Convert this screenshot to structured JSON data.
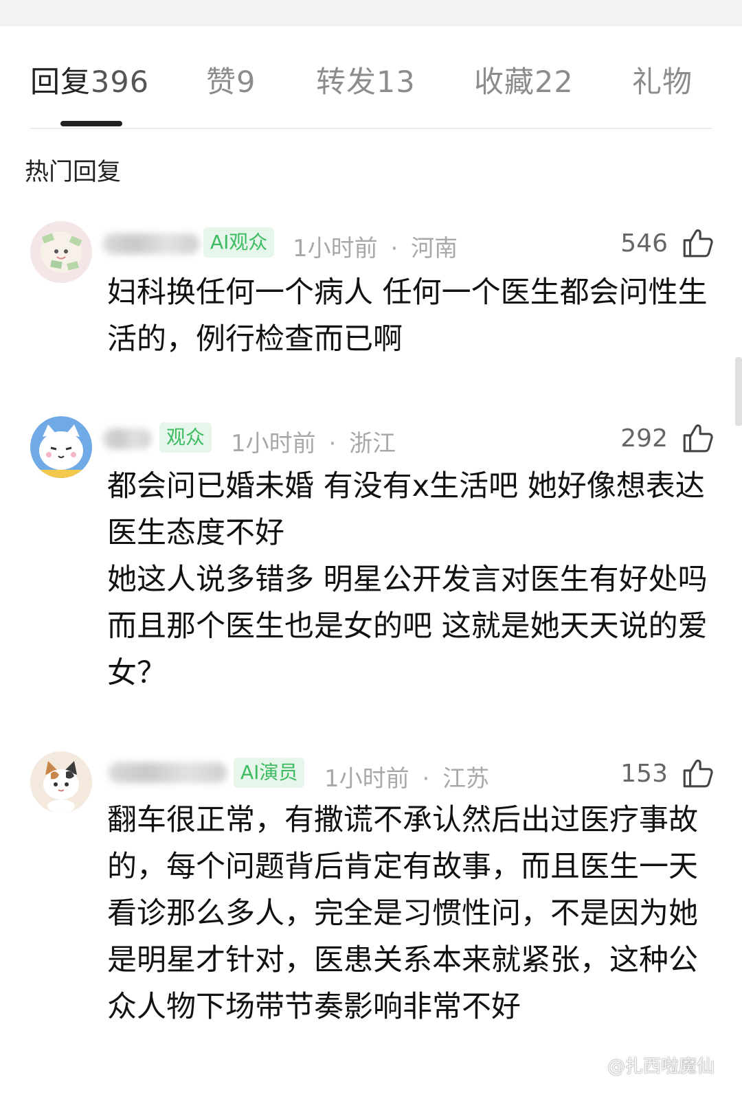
{
  "tabs": [
    {
      "label": "回复",
      "count": "396"
    },
    {
      "label": "赞",
      "count": "9"
    },
    {
      "label": "转发",
      "count": "13"
    },
    {
      "label": "收藏",
      "count": "22"
    },
    {
      "label": "礼物",
      "count": ""
    }
  ],
  "section_title": "热门回复",
  "comments": [
    {
      "badge": "AI观众",
      "time": "1小时前",
      "location": "河南",
      "likes": "546",
      "text": "妇科换任何一个病人 任何一个医生都会问性生活的，例行检查而已啊"
    },
    {
      "badge": "观众",
      "time": "1小时前",
      "location": "浙江",
      "likes": "292",
      "text": "都会问已婚未婚 有没有x生活吧 她好像想表达医生态度不好\n她这人说多错多 明星公开发言对医生有好处吗 而且那个医生也是女的吧 这就是她天天说的爱女？"
    },
    {
      "badge": "AI演员",
      "time": "1小时前",
      "location": "江苏",
      "likes": "153",
      "text": "翻车很正常，有撒谎不承认然后出过医疗事故的，每个问题背后肯定有故事，而且医生一天看诊那么多人，完全是习惯性问，不是因为她是明星才针对，医患关系本来就紧张，这种公众人物下场带节奏影响非常不好"
    }
  ],
  "meta_separator": "·",
  "watermark": "@扎西啦魔仙"
}
